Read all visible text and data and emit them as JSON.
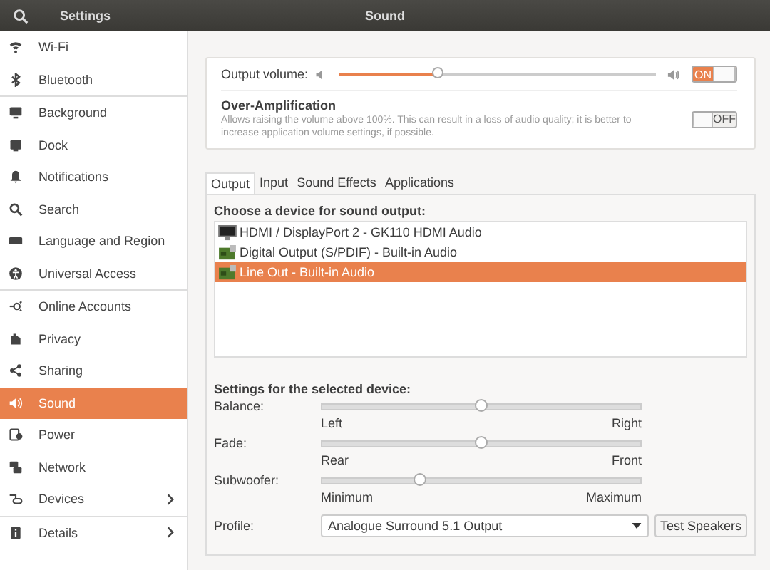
{
  "header": {
    "app_title": "Settings",
    "page_title": "Sound"
  },
  "sidebar": {
    "groups": [
      {
        "items": [
          {
            "label": "Wi-Fi",
            "selected": false,
            "submenu": false
          },
          {
            "label": "Bluetooth",
            "selected": false,
            "submenu": false
          }
        ]
      },
      {
        "items": [
          {
            "label": "Background",
            "selected": false,
            "submenu": false
          },
          {
            "label": "Dock",
            "selected": false,
            "submenu": false
          },
          {
            "label": "Notifications",
            "selected": false,
            "submenu": false
          },
          {
            "label": "Search",
            "selected": false,
            "submenu": false
          },
          {
            "label": "Language and Region",
            "selected": false,
            "submenu": false
          },
          {
            "label": "Universal Access",
            "selected": false,
            "submenu": false
          }
        ]
      },
      {
        "items": [
          {
            "label": "Online Accounts",
            "selected": false,
            "submenu": false
          },
          {
            "label": "Privacy",
            "selected": false,
            "submenu": false
          },
          {
            "label": "Sharing",
            "selected": false,
            "submenu": false
          },
          {
            "label": "Sound",
            "selected": true,
            "submenu": false
          },
          {
            "label": "Power",
            "selected": false,
            "submenu": false
          },
          {
            "label": "Network",
            "selected": false,
            "submenu": false
          },
          {
            "label": "Devices",
            "selected": false,
            "submenu": true
          }
        ]
      },
      {
        "items": [
          {
            "label": "Details",
            "selected": false,
            "submenu": true
          }
        ]
      }
    ]
  },
  "volume": {
    "label": "Output volume:",
    "level": 0.31,
    "switch": {
      "label": "ON",
      "on": true
    }
  },
  "over_amplification": {
    "title": "Over-Amplification",
    "description": "Allows raising the volume above 100%. This can result in a loss of audio quality; it is better to increase application volume settings, if possible.",
    "switch": {
      "label": "OFF",
      "on": false
    }
  },
  "tabs": [
    {
      "label": "Output",
      "selected": true
    },
    {
      "label": "Input",
      "selected": false
    },
    {
      "label": "Sound Effects",
      "selected": false
    },
    {
      "label": "Applications",
      "selected": false
    }
  ],
  "devices": {
    "heading": "Choose a device for sound output:",
    "items": [
      {
        "label": "HDMI / DisplayPort 2 - GK110 HDMI Audio",
        "kind": "display",
        "selected": false
      },
      {
        "label": "Digital Output (S/PDIF) - Built-in Audio",
        "kind": "card",
        "selected": false
      },
      {
        "label": "Line Out - Built-in Audio",
        "kind": "card",
        "selected": true
      }
    ]
  },
  "device_settings": {
    "heading": "Settings for the selected device:",
    "sliders": [
      {
        "label": "Balance:",
        "level": 0.5,
        "min_label": "Left",
        "max_label": "Right"
      },
      {
        "label": "Fade:",
        "level": 0.5,
        "min_label": "Rear",
        "max_label": "Front"
      },
      {
        "label": "Subwoofer:",
        "level": 0.31,
        "min_label": "Minimum",
        "max_label": "Maximum"
      }
    ],
    "profile": {
      "label": "Profile:",
      "value": "Analogue Surround 5.1 Output",
      "button": "Test Speakers"
    }
  }
}
